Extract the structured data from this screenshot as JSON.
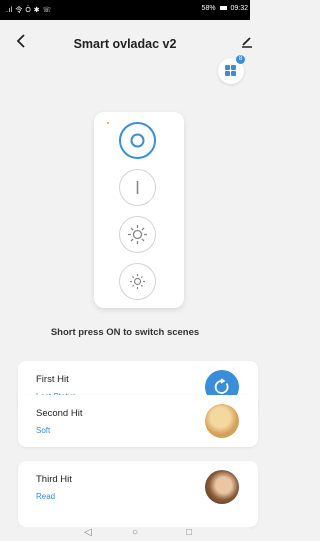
{
  "status_bar": {
    "left_icons": ".ıl 令 Ö ✱ ☏",
    "battery_percent": "58%",
    "time": "09:32"
  },
  "header": {
    "title": "Smart ovladac v2",
    "back_icon": "chevron-left-icon",
    "edit_icon": "edit-icon"
  },
  "scene_grid": {
    "icon": "grid-icon",
    "badge": "8"
  },
  "device_panel": {
    "buttons": [
      {
        "name": "scene-button",
        "icon": "circle-icon",
        "active": true
      },
      {
        "name": "on-button",
        "icon": "power-line-icon",
        "active": false
      },
      {
        "name": "brightness-up-button",
        "icon": "sun-large-icon",
        "active": false
      },
      {
        "name": "brightness-down-button",
        "icon": "sun-small-icon",
        "active": false
      }
    ]
  },
  "hint_text": "Short press ON to switch scenes",
  "scenes": [
    {
      "title": "First Hit",
      "subtitle": "Last Status",
      "icon": "refresh-icon"
    },
    {
      "title": "Second Hit",
      "subtitle": "Soft",
      "icon": "soft-thumbnail"
    },
    {
      "title": "Third Hit",
      "subtitle": "Read",
      "icon": "read-thumbnail"
    }
  ],
  "colors": {
    "accent": "#3a8dd9",
    "background": "#f2f2f2",
    "card": "#ffffff"
  }
}
